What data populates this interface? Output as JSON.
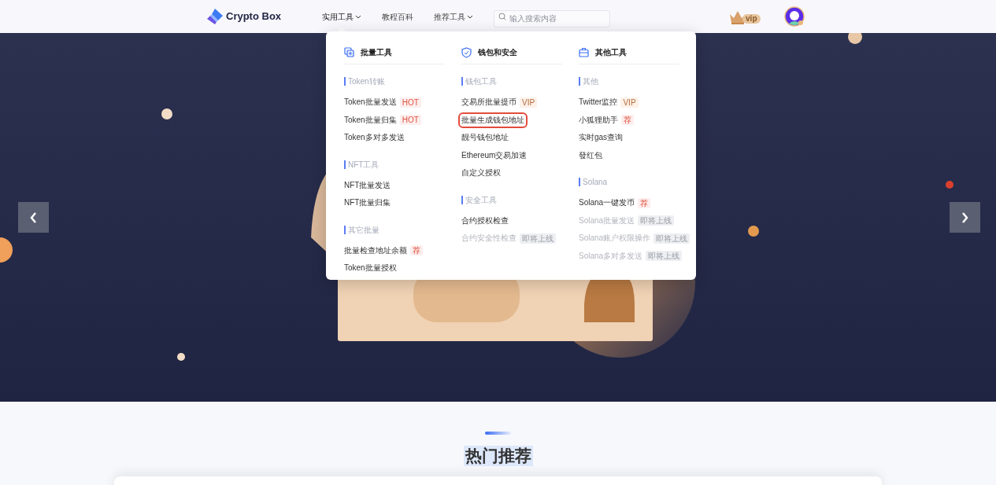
{
  "header": {
    "logo": "Crypto Box",
    "nav": [
      {
        "label": "实用工具",
        "dropdown": true,
        "selected": true
      },
      {
        "label": "教程百科",
        "dropdown": false,
        "selected": false
      },
      {
        "label": "推荐工具",
        "dropdown": true,
        "selected": false
      }
    ],
    "search": {
      "placeholder": "输入搜索内容"
    },
    "vip": "vip"
  },
  "menu": {
    "columns": [
      {
        "title": "批量工具",
        "groups": [
          {
            "title": "Token转账",
            "items": [
              {
                "label": "Token批量发送",
                "tag": {
                  "text": "HOT",
                  "kind": "hot"
                },
                "disabled": false,
                "highlighted": false
              },
              {
                "label": "Token批量归集",
                "tag": {
                  "text": "HOT",
                  "kind": "hot"
                },
                "disabled": false,
                "highlighted": false
              },
              {
                "label": "Token多对多发送",
                "disabled": false,
                "highlighted": false
              }
            ]
          },
          {
            "title": "NFT工具",
            "items": [
              {
                "label": "NFT批量发送",
                "disabled": false,
                "highlighted": false
              },
              {
                "label": "NFT批量归集",
                "disabled": false,
                "highlighted": false
              }
            ]
          },
          {
            "title": "其它批量",
            "items": [
              {
                "label": "批量检查地址余额",
                "tag": {
                  "text": "荐",
                  "kind": "hot"
                },
                "disabled": false,
                "highlighted": false
              },
              {
                "label": "Token批量授权",
                "disabled": false,
                "highlighted": false
              }
            ]
          }
        ]
      },
      {
        "title": "钱包和安全",
        "groups": [
          {
            "title": "钱包工具",
            "items": [
              {
                "label": "交易所批量提币",
                "tag": {
                  "text": "VIP",
                  "kind": "vip"
                },
                "disabled": false,
                "highlighted": false
              },
              {
                "label": "批量生成钱包地址",
                "disabled": false,
                "highlighted": true
              },
              {
                "label": "靓号钱包地址",
                "disabled": false,
                "highlighted": false
              },
              {
                "label": "Ethereum交易加速",
                "disabled": false,
                "highlighted": false
              },
              {
                "label": "自定义授权",
                "disabled": false,
                "highlighted": false
              }
            ]
          },
          {
            "title": "安全工具",
            "items": [
              {
                "label": "合约授权检查",
                "disabled": false,
                "highlighted": false
              },
              {
                "label": "合约安全性检查",
                "tag": {
                  "text": "即将上线",
                  "kind": "soon"
                },
                "disabled": true,
                "highlighted": false
              }
            ]
          }
        ]
      },
      {
        "title": "其他工具",
        "groups": [
          {
            "title": "其他",
            "items": [
              {
                "label": "Twitter监控",
                "tag": {
                  "text": "VIP",
                  "kind": "vip"
                },
                "disabled": false,
                "highlighted": false
              },
              {
                "label": "小狐狸助手",
                "tag": {
                  "text": "荐",
                  "kind": "hot"
                },
                "disabled": false,
                "highlighted": false
              },
              {
                "label": "实时gas查询",
                "disabled": false,
                "highlighted": false
              },
              {
                "label": "發红包",
                "disabled": false,
                "highlighted": false
              }
            ]
          },
          {
            "title": "Solana",
            "items": [
              {
                "label": "Solana一键发币",
                "tag": {
                  "text": "荐",
                  "kind": "hot"
                },
                "disabled": false,
                "highlighted": false
              },
              {
                "label": "Solana批量发送",
                "tag": {
                  "text": "即将上线",
                  "kind": "soon"
                },
                "disabled": true,
                "highlighted": false
              },
              {
                "label": "Solana账户权限操作",
                "tag": {
                  "text": "即将上线",
                  "kind": "soon"
                },
                "disabled": true,
                "highlighted": false
              },
              {
                "label": "Solana多对多发送",
                "tag": {
                  "text": "即将上线",
                  "kind": "soon"
                },
                "disabled": true,
                "highlighted": false
              }
            ]
          }
        ]
      }
    ]
  },
  "section": {
    "title": "热门推荐"
  }
}
